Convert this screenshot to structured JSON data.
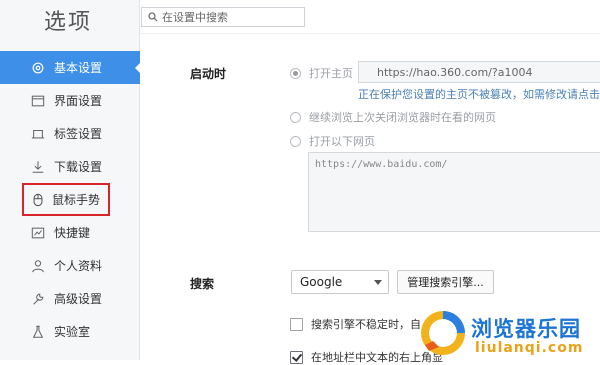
{
  "app": {
    "title": "选项"
  },
  "search": {
    "placeholder": "在设置中搜索",
    "icon": "search-icon"
  },
  "sidebar": {
    "items": [
      {
        "label": "基本设置",
        "icon": "gear-icon",
        "active": true
      },
      {
        "label": "界面设置",
        "icon": "window-icon"
      },
      {
        "label": "标签设置",
        "icon": "tab-icon"
      },
      {
        "label": "下载设置",
        "icon": "download-icon"
      },
      {
        "label": "鼠标手势",
        "icon": "mouse-icon",
        "highlighted": true
      },
      {
        "label": "快捷键",
        "icon": "keyboard-icon"
      },
      {
        "label": "个人资料",
        "icon": "user-icon"
      },
      {
        "label": "高级设置",
        "icon": "wrench-icon"
      },
      {
        "label": "实验室",
        "icon": "flask-icon"
      }
    ]
  },
  "startup": {
    "label": "启动时",
    "option_homepage": "打开主页",
    "homepage_url": "https://hao.360.com/?a1004",
    "protection_notice": "正在保护您设置的主页不被篡改，如需修改请点击",
    "option_restore": "继续浏览上次关闭浏览器时在看的网页",
    "option_pages": "打开以下网页",
    "pages_value": "https://www.baidu.com/"
  },
  "search_engine": {
    "label": "搜索",
    "selected": "Google",
    "manage_button": "管理搜索引擎...",
    "option_unstable": "搜索引擎不稳定时，自",
    "option_selected_text": "在地址栏中文本的右上角显"
  },
  "watermark": {
    "text": "浏览器乐园",
    "sub": "liulanqi.com"
  },
  "colors": {
    "accent": "#3d8fe8",
    "highlight_border": "#d9242c",
    "notice": "#4a7fb5"
  }
}
